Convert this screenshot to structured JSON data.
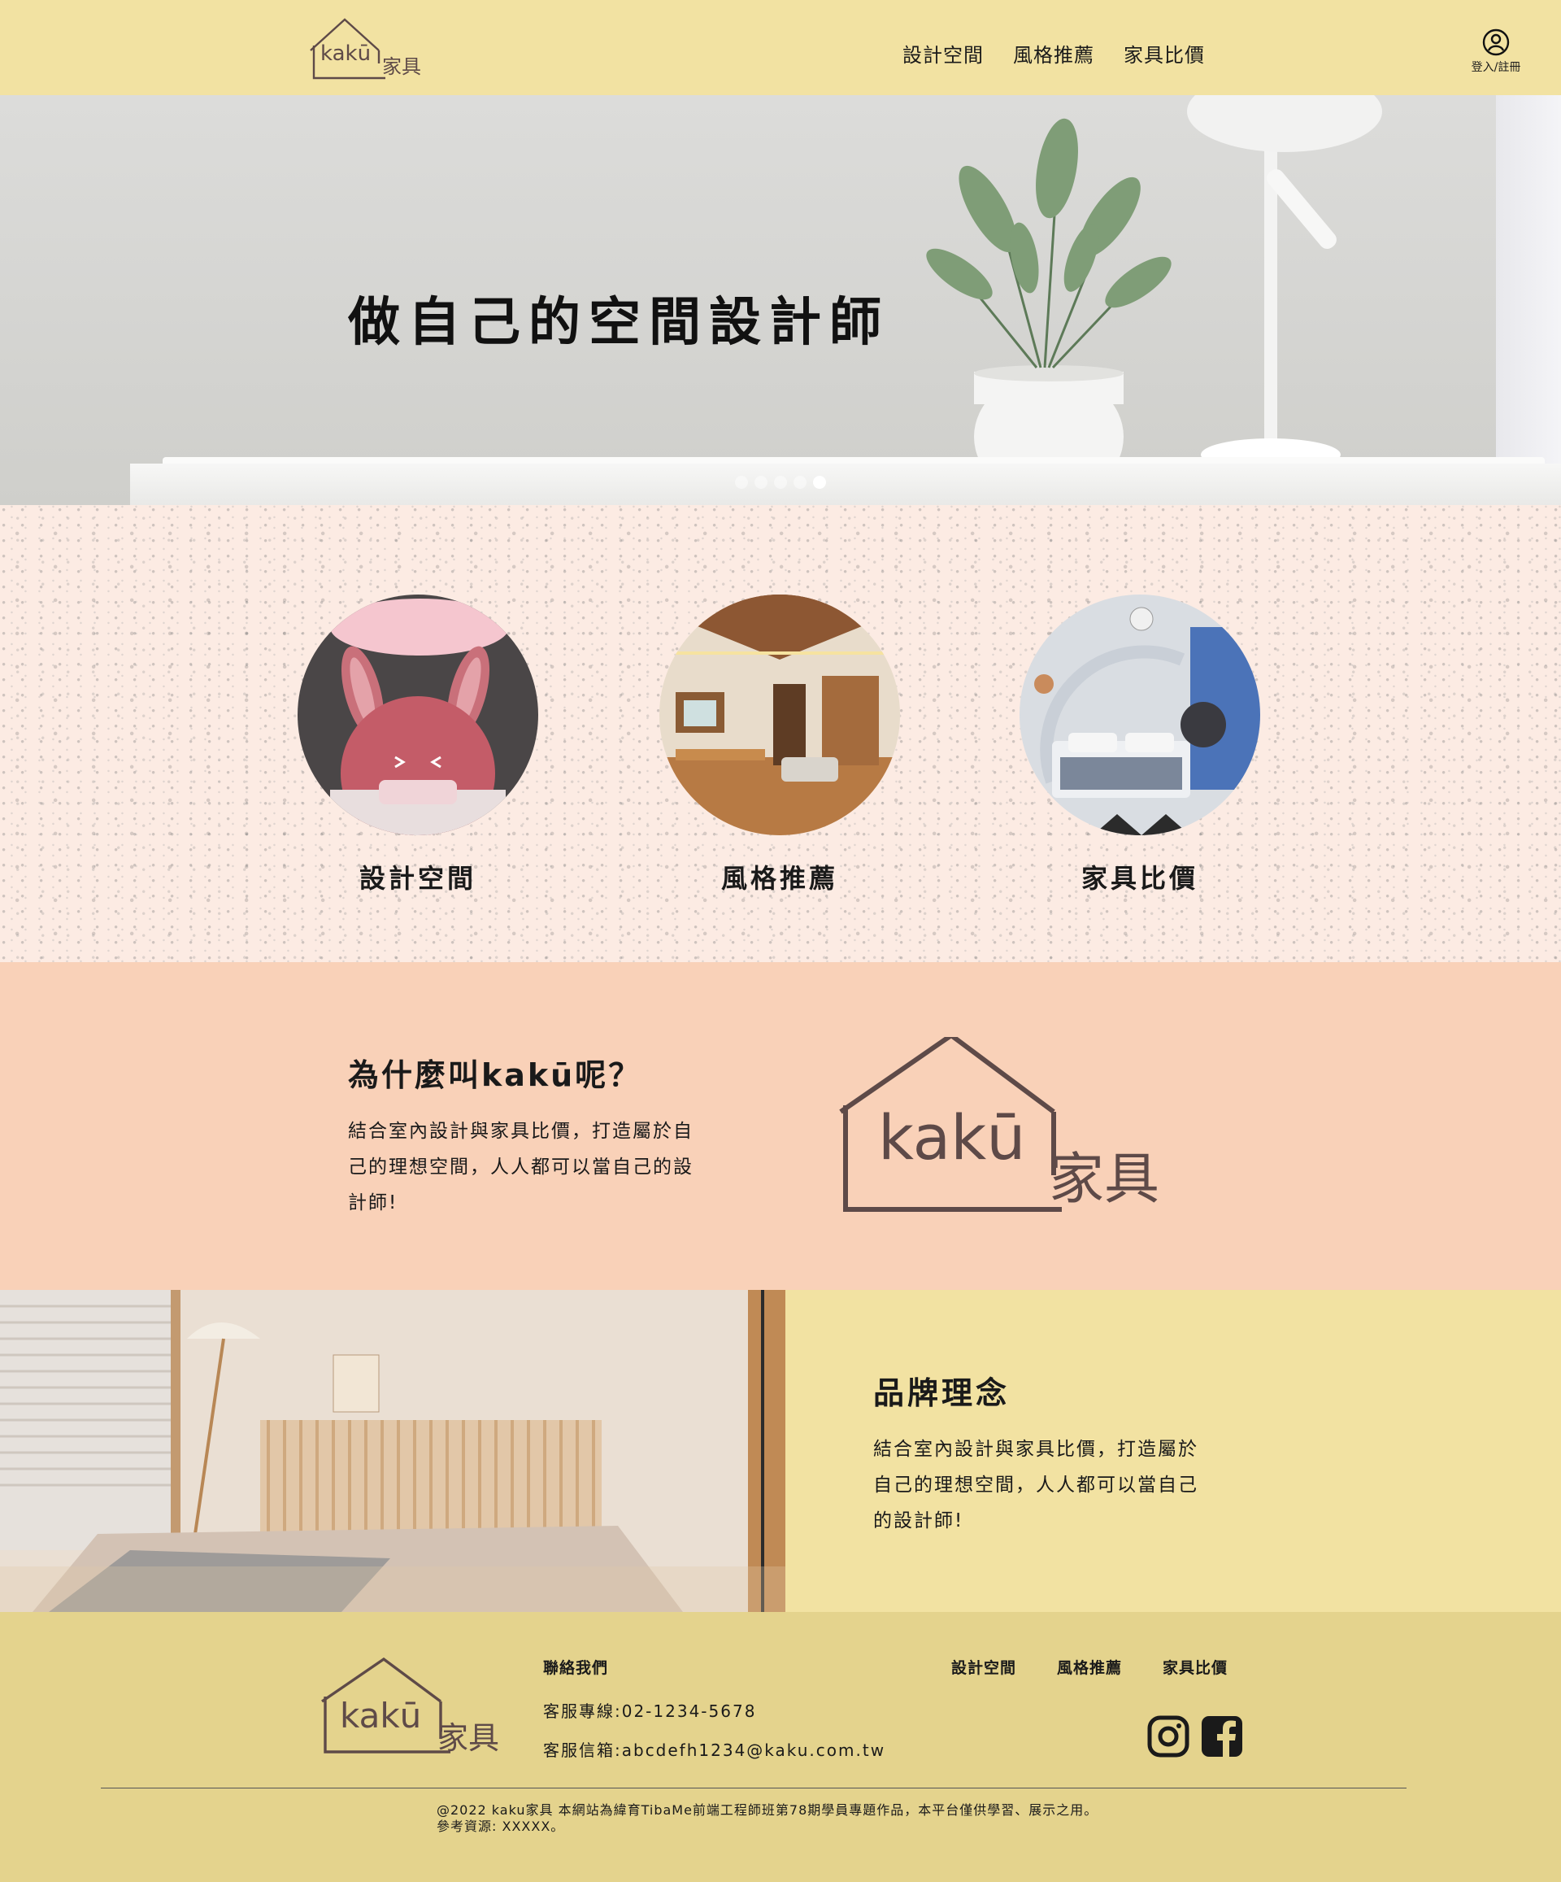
{
  "header": {
    "logo_text": "kakū家具",
    "nav": [
      "設計空間",
      "風格推薦",
      "家具比價"
    ],
    "account_label": "登入/註冊"
  },
  "hero": {
    "title": "做自己的空間設計師",
    "slide_count": 5,
    "active_slide": 5
  },
  "categories": [
    {
      "label": "設計空間"
    },
    {
      "label": "風格推薦"
    },
    {
      "label": "家具比價"
    }
  ],
  "why": {
    "title": "為什麼叫kakū呢？",
    "body": "結合室內設計與家具比價，打造屬於自己的理想空間，人人都可以當自己的設計師!"
  },
  "brand": {
    "title": "品牌理念",
    "body": "結合室內設計與家具比價，打造屬於自己的理想空間，人人都可以當自己的設計師!"
  },
  "footer": {
    "contact_heading": "聯絡我們",
    "phone": "客服專線:02-1234-5678",
    "email": "客服信箱:abcdefh1234@kaku.com.tw",
    "nav": [
      "設計空間",
      "風格推薦",
      "家具比價"
    ],
    "social": [
      "instagram-icon",
      "facebook-icon"
    ],
    "copyright_line1": "@2022 kaku家具 本網站為緯育TibaMe前端工程師班第78期學員專題作品，本平台僅供學習、展示之用。",
    "copyright_line2": "參考資源: XXXXX。"
  },
  "colors": {
    "header_bg": "#f2e2a2",
    "category_bg": "#fcebe3",
    "why_bg": "#f9d1b8",
    "footer_bg": "#e4d38d",
    "logo_brown": "#5e4a48"
  }
}
